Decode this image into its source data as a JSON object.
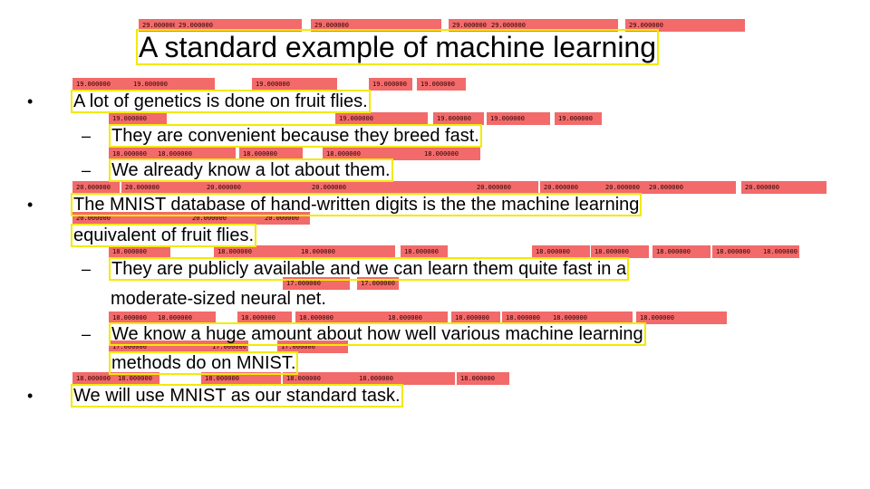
{
  "slide": {
    "title": "A standard example of machine learning",
    "bullets": [
      {
        "text": "A lot of genetics is done on fruit flies.",
        "subs": [
          "They are convenient because they breed fast.",
          "We already know a lot about them."
        ]
      },
      {
        "text": "The MNIST database of hand-written digits is the the machine learning",
        "text2": "equivalent of fruit flies.",
        "subs": [
          "They are publicly available and we can learn them quite fast in a",
          "moderate-sized neural net.",
          "We know a huge amount about how well various machine learning",
          "methods do on MNIST."
        ]
      },
      {
        "text": "We will use MNIST as our standard task.",
        "subs": []
      }
    ],
    "bullet_symbol": "•",
    "dash_symbol": "–"
  },
  "annotations": {
    "title_size": "29.000000",
    "size_19": "19.000000",
    "size_18": "18.000000",
    "size_20": "20.000000",
    "size_17": "17.000000"
  },
  "colors": {
    "label_fill": "#f26a6a",
    "box_outline": "#f2ea00"
  }
}
